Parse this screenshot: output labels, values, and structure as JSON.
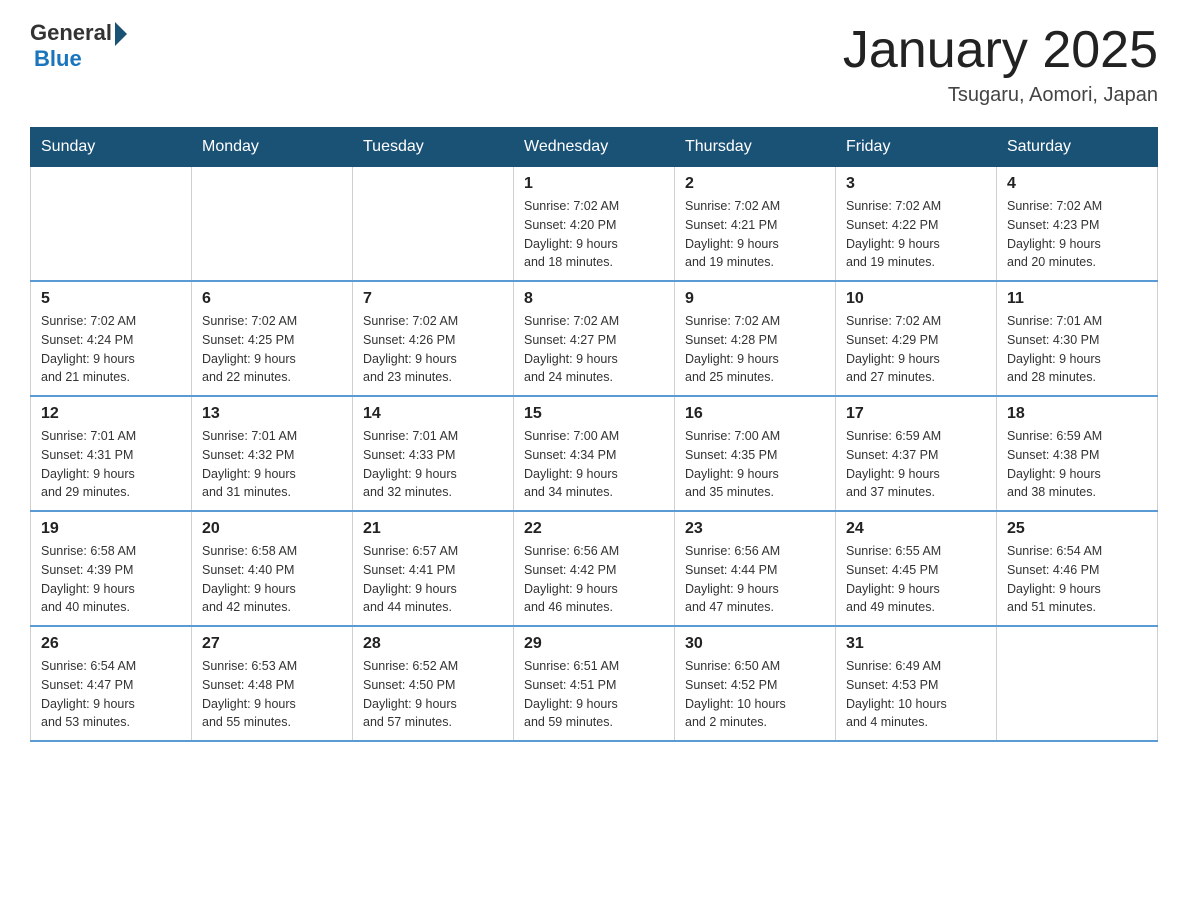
{
  "header": {
    "logo_general": "General",
    "logo_blue": "Blue",
    "title": "January 2025",
    "subtitle": "Tsugaru, Aomori, Japan"
  },
  "days_of_week": [
    "Sunday",
    "Monday",
    "Tuesday",
    "Wednesday",
    "Thursday",
    "Friday",
    "Saturday"
  ],
  "weeks": [
    [
      {
        "day": "",
        "info": ""
      },
      {
        "day": "",
        "info": ""
      },
      {
        "day": "",
        "info": ""
      },
      {
        "day": "1",
        "info": "Sunrise: 7:02 AM\nSunset: 4:20 PM\nDaylight: 9 hours\nand 18 minutes."
      },
      {
        "day": "2",
        "info": "Sunrise: 7:02 AM\nSunset: 4:21 PM\nDaylight: 9 hours\nand 19 minutes."
      },
      {
        "day": "3",
        "info": "Sunrise: 7:02 AM\nSunset: 4:22 PM\nDaylight: 9 hours\nand 19 minutes."
      },
      {
        "day": "4",
        "info": "Sunrise: 7:02 AM\nSunset: 4:23 PM\nDaylight: 9 hours\nand 20 minutes."
      }
    ],
    [
      {
        "day": "5",
        "info": "Sunrise: 7:02 AM\nSunset: 4:24 PM\nDaylight: 9 hours\nand 21 minutes."
      },
      {
        "day": "6",
        "info": "Sunrise: 7:02 AM\nSunset: 4:25 PM\nDaylight: 9 hours\nand 22 minutes."
      },
      {
        "day": "7",
        "info": "Sunrise: 7:02 AM\nSunset: 4:26 PM\nDaylight: 9 hours\nand 23 minutes."
      },
      {
        "day": "8",
        "info": "Sunrise: 7:02 AM\nSunset: 4:27 PM\nDaylight: 9 hours\nand 24 minutes."
      },
      {
        "day": "9",
        "info": "Sunrise: 7:02 AM\nSunset: 4:28 PM\nDaylight: 9 hours\nand 25 minutes."
      },
      {
        "day": "10",
        "info": "Sunrise: 7:02 AM\nSunset: 4:29 PM\nDaylight: 9 hours\nand 27 minutes."
      },
      {
        "day": "11",
        "info": "Sunrise: 7:01 AM\nSunset: 4:30 PM\nDaylight: 9 hours\nand 28 minutes."
      }
    ],
    [
      {
        "day": "12",
        "info": "Sunrise: 7:01 AM\nSunset: 4:31 PM\nDaylight: 9 hours\nand 29 minutes."
      },
      {
        "day": "13",
        "info": "Sunrise: 7:01 AM\nSunset: 4:32 PM\nDaylight: 9 hours\nand 31 minutes."
      },
      {
        "day": "14",
        "info": "Sunrise: 7:01 AM\nSunset: 4:33 PM\nDaylight: 9 hours\nand 32 minutes."
      },
      {
        "day": "15",
        "info": "Sunrise: 7:00 AM\nSunset: 4:34 PM\nDaylight: 9 hours\nand 34 minutes."
      },
      {
        "day": "16",
        "info": "Sunrise: 7:00 AM\nSunset: 4:35 PM\nDaylight: 9 hours\nand 35 minutes."
      },
      {
        "day": "17",
        "info": "Sunrise: 6:59 AM\nSunset: 4:37 PM\nDaylight: 9 hours\nand 37 minutes."
      },
      {
        "day": "18",
        "info": "Sunrise: 6:59 AM\nSunset: 4:38 PM\nDaylight: 9 hours\nand 38 minutes."
      }
    ],
    [
      {
        "day": "19",
        "info": "Sunrise: 6:58 AM\nSunset: 4:39 PM\nDaylight: 9 hours\nand 40 minutes."
      },
      {
        "day": "20",
        "info": "Sunrise: 6:58 AM\nSunset: 4:40 PM\nDaylight: 9 hours\nand 42 minutes."
      },
      {
        "day": "21",
        "info": "Sunrise: 6:57 AM\nSunset: 4:41 PM\nDaylight: 9 hours\nand 44 minutes."
      },
      {
        "day": "22",
        "info": "Sunrise: 6:56 AM\nSunset: 4:42 PM\nDaylight: 9 hours\nand 46 minutes."
      },
      {
        "day": "23",
        "info": "Sunrise: 6:56 AM\nSunset: 4:44 PM\nDaylight: 9 hours\nand 47 minutes."
      },
      {
        "day": "24",
        "info": "Sunrise: 6:55 AM\nSunset: 4:45 PM\nDaylight: 9 hours\nand 49 minutes."
      },
      {
        "day": "25",
        "info": "Sunrise: 6:54 AM\nSunset: 4:46 PM\nDaylight: 9 hours\nand 51 minutes."
      }
    ],
    [
      {
        "day": "26",
        "info": "Sunrise: 6:54 AM\nSunset: 4:47 PM\nDaylight: 9 hours\nand 53 minutes."
      },
      {
        "day": "27",
        "info": "Sunrise: 6:53 AM\nSunset: 4:48 PM\nDaylight: 9 hours\nand 55 minutes."
      },
      {
        "day": "28",
        "info": "Sunrise: 6:52 AM\nSunset: 4:50 PM\nDaylight: 9 hours\nand 57 minutes."
      },
      {
        "day": "29",
        "info": "Sunrise: 6:51 AM\nSunset: 4:51 PM\nDaylight: 9 hours\nand 59 minutes."
      },
      {
        "day": "30",
        "info": "Sunrise: 6:50 AM\nSunset: 4:52 PM\nDaylight: 10 hours\nand 2 minutes."
      },
      {
        "day": "31",
        "info": "Sunrise: 6:49 AM\nSunset: 4:53 PM\nDaylight: 10 hours\nand 4 minutes."
      },
      {
        "day": "",
        "info": ""
      }
    ]
  ]
}
